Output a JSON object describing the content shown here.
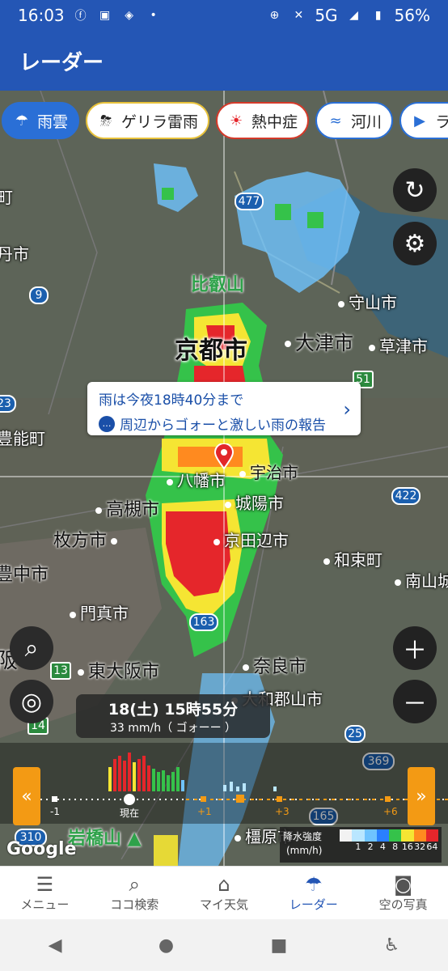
{
  "status": {
    "time": "16:03",
    "network": "5G",
    "battery": "56%"
  },
  "app": {
    "title": "レーダー"
  },
  "chips": [
    {
      "label": "雨雲"
    },
    {
      "label": "ゲリラ雷雨"
    },
    {
      "label": "熱中症"
    },
    {
      "label": "河川"
    },
    {
      "label": "ライブ"
    }
  ],
  "map": {
    "labels": {
      "kyoto": "京都市",
      "otsu": "大津市",
      "hieizan": "比叡山",
      "moriyama": "守山市",
      "kusatsu": "草津市",
      "toyono": "豊能町",
      "yawata": "八幡市",
      "uji": "宇治市",
      "joyo": "城陽市",
      "takatsuki": "高槻市",
      "hirakata": "枚方市",
      "kyotanabe": "京田辺市",
      "wazuka": "和束町",
      "minamiyamashiro": "南山城",
      "toyonaka": "豊中市",
      "kadoma": "門真市",
      "higashiosaka": "東大阪市",
      "nara": "奈良市",
      "yamatokoriyama": "大和郡山市",
      "osaka": "阪",
      "iwahashi": "岩橋山",
      "kashihara": "橿原市",
      "tanba": "丹市",
      "routes": [
        "477",
        "9",
        "51",
        "23",
        "422",
        "163",
        "13",
        "14",
        "25",
        "369",
        "165",
        "310",
        "25"
      ]
    },
    "callout": {
      "line1": "雨は今夜18時40分まで",
      "line2": "周辺からゴォーと激しい雨の報告"
    },
    "time": {
      "main": "18(土) 15時55分",
      "sub": "33 mm/h（ ゴォーー ）"
    },
    "timeline": {
      "ticks": [
        "-1",
        "現在",
        "+1",
        "+3",
        "+6"
      ]
    },
    "legend": {
      "title": "降水強度",
      "unit": "(mm/h)",
      "values": [
        "1",
        "2",
        "4",
        "8",
        "16",
        "32",
        "64"
      ],
      "colors": [
        "#f2f2f2",
        "#b9e6ff",
        "#6fc3ff",
        "#2a7fff",
        "#35c24a",
        "#f5e533",
        "#ff8a1f",
        "#e5262b"
      ]
    },
    "google": "Google"
  },
  "nav": [
    {
      "label": "メニュー"
    },
    {
      "label": "ココ検索"
    },
    {
      "label": "マイ天気"
    },
    {
      "label": "レーダー"
    },
    {
      "label": "空の写真"
    }
  ]
}
